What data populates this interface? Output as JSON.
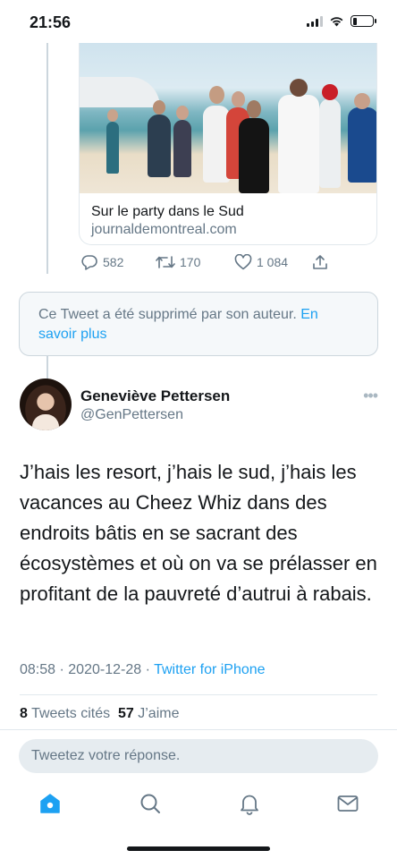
{
  "status_bar": {
    "time": "21:56",
    "battery_level": 0.2
  },
  "quoted_card": {
    "title": "Sur le party dans le Sud",
    "domain": "journaldemontreal.com"
  },
  "actions": {
    "replies": "582",
    "retweets": "170",
    "likes": "1 084"
  },
  "deleted_notice": {
    "text": "Ce Tweet a été supprimé par son auteur. ",
    "link": "En savoir plus"
  },
  "tweet": {
    "display_name": "Geneviève Pettersen",
    "handle": "@GenPettersen",
    "text": "J’hais les resort, j’hais le sud, j’hais les vacances au Cheez Whiz dans des endroits bâtis en se sacrant des écosystèmes et où on va se prélasser en profitant de la pauvreté d’autrui à rabais.",
    "time": "08:58",
    "date": "2020-12-28",
    "separator": "·",
    "source": "Twitter for iPhone",
    "quote_count": "8",
    "quote_label": "Tweets cités",
    "like_count": "57",
    "like_label": "J’aime"
  },
  "reply": {
    "placeholder": "Tweetez votre réponse."
  },
  "tab_bar": {
    "tabs": [
      "home-icon",
      "search-icon",
      "notifications-icon",
      "messages-icon"
    ],
    "active": "home-icon",
    "accent_color": "#1da1f2"
  },
  "colors": {
    "accent": "#1da1f2",
    "secondary_text": "#657786",
    "primary_text": "#14171a",
    "border": "#e1e8ed"
  }
}
